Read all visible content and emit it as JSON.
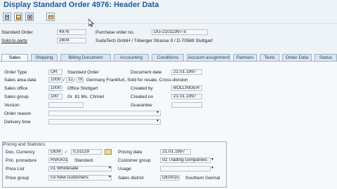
{
  "window": {
    "title": "Display Standard Order 4976: Header Data"
  },
  "header": {
    "standard_order_label": "Standard Order",
    "standard_order_value": "4976",
    "sold_to_label": "Sold-to party",
    "sold_to_value": "2804",
    "purchase_order_label": "Purchase order no.",
    "purchase_order_value": "DG-21011997-5",
    "sold_to_address": "SudaTech GmbH / Triberger Strasse 9 / D-70569 Stuttgart"
  },
  "tabs": [
    "Sales",
    "Shipping",
    "Billing Document",
    "Accounting",
    "Conditions",
    "Account assignment",
    "Partners",
    "Texts",
    "Order Data",
    "Status"
  ],
  "sales": {
    "order_type_label": "Order Type",
    "order_type_code": "OR",
    "order_type_desc": "Standard Order",
    "sales_area_label": "Sales area data",
    "sales_area_1": "1000",
    "sales_area_2": "12",
    "sales_area_3": "00",
    "sales_area_desc": "Germany Frankfurt, Sold for resale, Cross-division",
    "sales_office_label": "Sales office",
    "sales_office_code": "1000",
    "sales_office_desc": "Office Stuttgart",
    "sales_group_label": "Sales group",
    "sales_group_code": "100",
    "sales_group_desc": "Gr. 81 Ms. Chmiel",
    "version_label": "Version",
    "order_reason_label": "Order reason",
    "delivery_time_label": "Delivery time",
    "document_date_label": "Document date",
    "document_date_value": "21.01.1997",
    "created_by_label": "Created by",
    "created_by_value": "BOLLINGER",
    "created_on_label": "Created on",
    "created_on_value": "21.01.1997",
    "guarantee_label": "Guarantee"
  },
  "pricing": {
    "group_title": "Pricing and Statistics",
    "doc_currency_label": "Doc. Currency",
    "doc_currency_value": "DEM",
    "slash": "/",
    "rate_value": "0,51129",
    "pricing_date_label": "Pricing date",
    "pricing_date_value": "21.01.1997",
    "pric_procedure_label": "Pric. procedure",
    "pric_procedure_code": "RVAA01",
    "pric_procedure_desc": "Standard",
    "customer_group_label": "Customer group",
    "customer_group_value": "02 Trading companies",
    "price_list_label": "Price List",
    "price_list_value": "01 Wholesale",
    "usage_label": "Usage",
    "price_group_label": "Price group",
    "price_group_value": "03 New customers",
    "sales_district_label": "Sales district",
    "sales_district_code": "DE0015",
    "sales_district_desc": "Southern Germal"
  },
  "colors": {
    "title": "#1f5c9d",
    "background": "#eef3f8",
    "panel": "#f6f9fc",
    "tab_border": "#9fb1c4"
  },
  "icons": [
    "display-change-icon",
    "header-details-icon",
    "item-overview-icon",
    "orders-icon",
    "mouse-cursor-icon"
  ]
}
